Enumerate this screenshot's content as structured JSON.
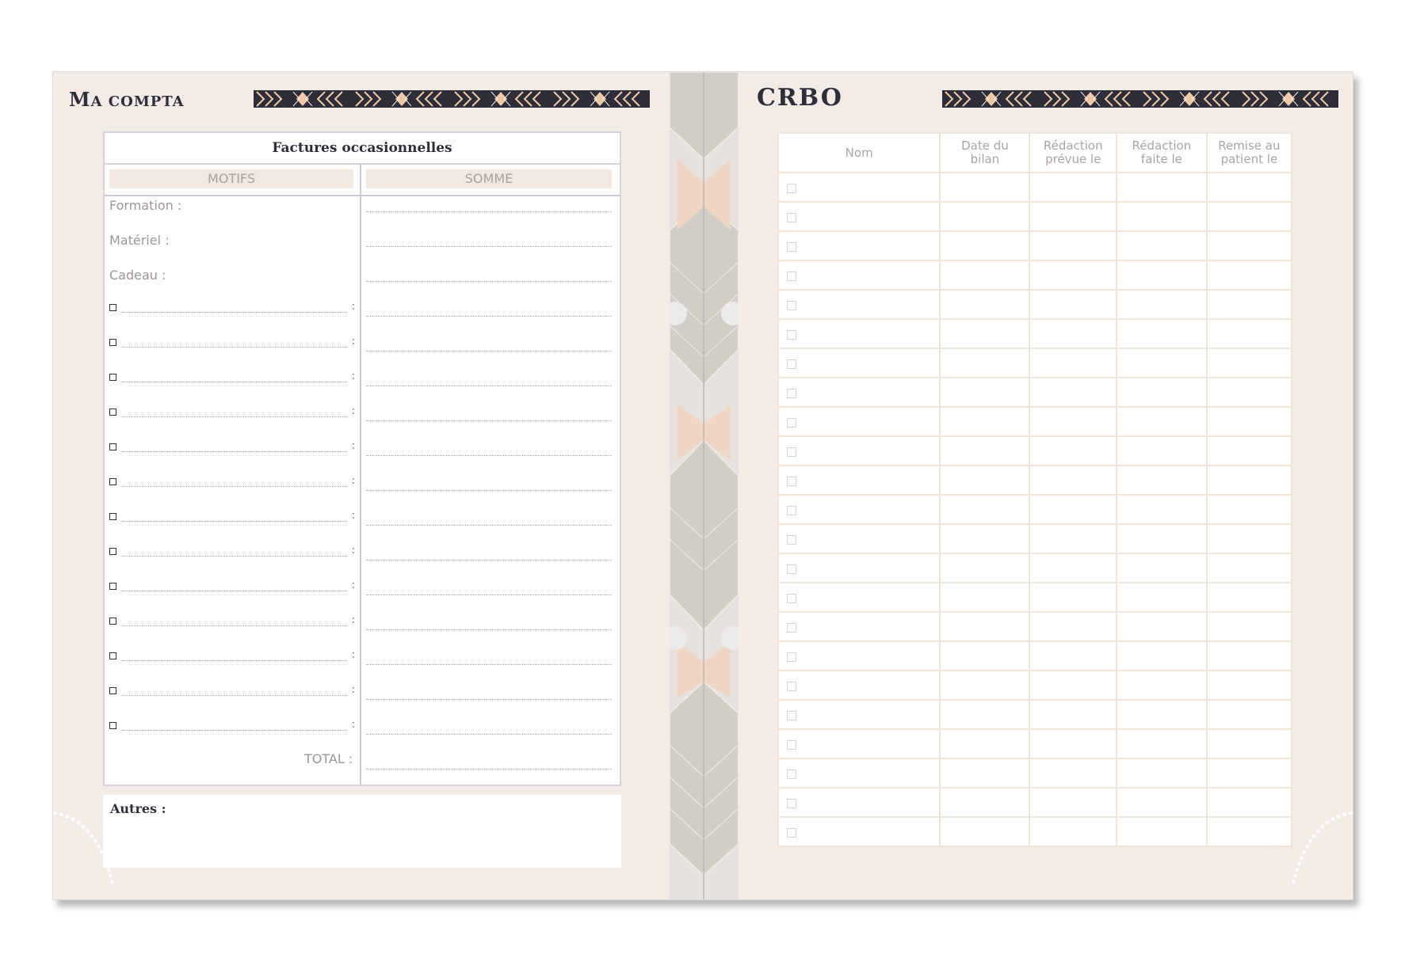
{
  "left_page": {
    "title_first": "M",
    "title_rest": "A COMPTA",
    "factures": {
      "title": "Factures occasionnelles",
      "motifs_header": "MOTIFS",
      "somme_header": "SOMME",
      "fixed_items": [
        "Formation :",
        "Matériel :",
        "Cadeau :"
      ],
      "item_colon": ":",
      "blank_item_count": 13,
      "total_label": "TOTAL :"
    },
    "autres_label": "Autres :"
  },
  "right_page": {
    "title": "CRBO",
    "columns": [
      "Nom",
      "Date du bilan",
      "Rédaction prévue le",
      "Rédaction faite le",
      "Remise au patient le"
    ],
    "row_count": 23
  },
  "colors": {
    "page": "#f3ece6",
    "dark": "#2e2e3a",
    "accent_peach": "#f0c9a8",
    "binding": "#e6e1dc",
    "table_border": "#f0e4d9"
  }
}
